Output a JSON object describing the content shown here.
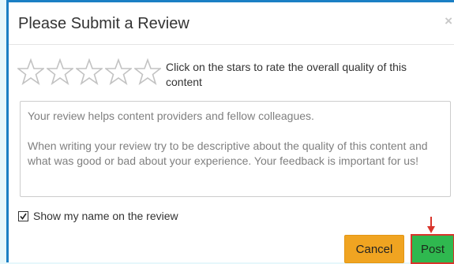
{
  "modal": {
    "title": "Please Submit a Review",
    "close_glyph": "×"
  },
  "rating": {
    "max_stars": 5,
    "current_rating": 0,
    "prompt": "Click on the stars to rate the overall quality of this content",
    "star_color": "#c2c2c2"
  },
  "review": {
    "placeholder_line1": "Your review helps content providers and fellow colleagues.",
    "placeholder_line2": "When writing your review try to be descriptive about the quality of this content and what was good or bad about your experience. Your feedback is important for us!",
    "value": ""
  },
  "show_name": {
    "label": "Show my name on the review",
    "checked": true
  },
  "buttons": {
    "cancel_label": "Cancel",
    "post_label": "Post"
  },
  "colors": {
    "modal_border": "#1b7fc4",
    "cancel_bg": "#f0a421",
    "post_bg": "#2fb84f",
    "highlight_red": "#d9342b"
  },
  "icons": {
    "close": "close-icon",
    "star": "star-outline-icon",
    "checkbox": "checkmark-icon",
    "pointer": "arrow-down-icon"
  }
}
